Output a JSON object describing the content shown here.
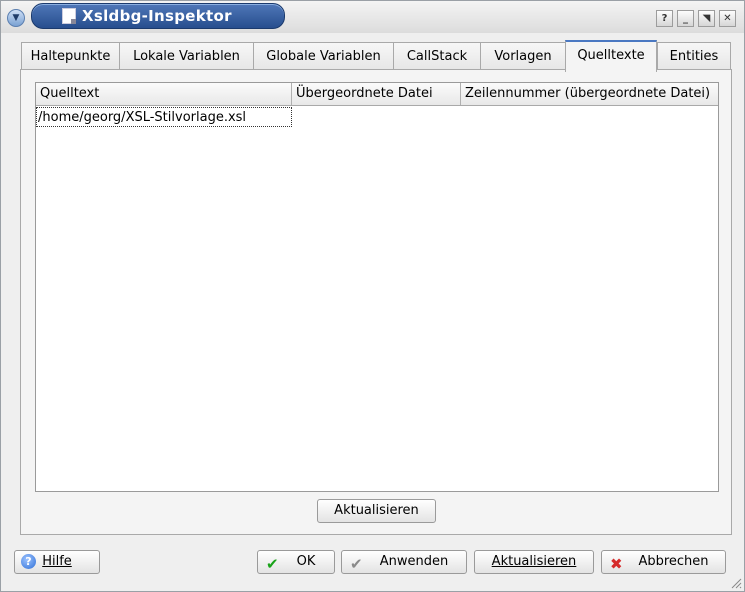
{
  "window": {
    "title": "Xsldbg-Inspektor",
    "buttons": {
      "help": "?",
      "minimize": "_",
      "maximize": "◥",
      "close": "✕"
    }
  },
  "tabs": [
    {
      "label": "Haltepunkte",
      "active": false
    },
    {
      "label": "Lokale Variablen",
      "active": false
    },
    {
      "label": "Globale Variablen",
      "active": false
    },
    {
      "label": "CallStack",
      "active": false
    },
    {
      "label": "Vorlagen",
      "active": false
    },
    {
      "label": "Quelltexte",
      "active": true
    },
    {
      "label": "Entities",
      "active": false
    }
  ],
  "sources_table": {
    "columns": [
      "Quelltext",
      "Übergeordnete Datei",
      "Zeilennummer (übergeordnete Datei)"
    ],
    "rows": [
      [
        "/home/georg/XSL-Stilvorlage.xsl",
        "",
        ""
      ]
    ]
  },
  "panel_refresh_label": "Aktualisieren",
  "footer": {
    "help_label": "Hilfe",
    "ok_label": "OK",
    "apply_label": "Anwenden",
    "refresh_label": "Aktualisieren",
    "cancel_label": "Abbrechen"
  },
  "icons": {
    "help": "help-icon",
    "ok": "check-icon",
    "apply": "check-gray-icon",
    "cancel": "cross-icon"
  },
  "colors": {
    "title_bar": "#274e8e",
    "active_tab_accent": "#4a78c2",
    "ok_check": "#19a319",
    "cancel_cross": "#d62b2b"
  }
}
